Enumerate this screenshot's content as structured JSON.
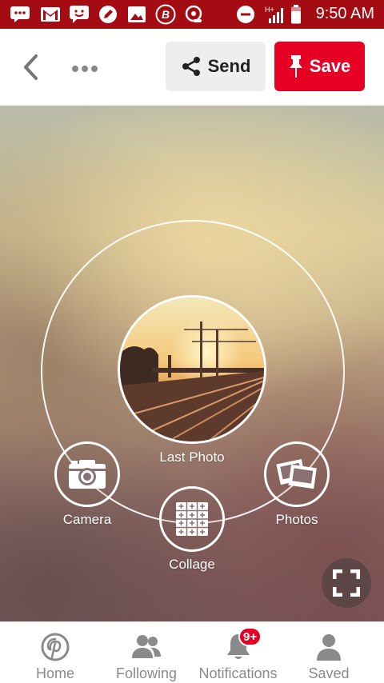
{
  "status_bar": {
    "time": "9:50 AM",
    "icons": [
      "chat-icon",
      "gmail-icon",
      "sms-icon",
      "edit-icon",
      "image-icon",
      "bolt-icon",
      "headset-icon",
      "dnd-icon",
      "signal-icon",
      "battery-icon"
    ],
    "network_label": "H+",
    "color": "#a50b12"
  },
  "toolbar": {
    "send_label": "Send",
    "save_label": "Save",
    "accent": "#e60023"
  },
  "camera": {
    "last_photo_label": "Last Photo",
    "camera_label": "Camera",
    "collage_label": "Collage",
    "photos_label": "Photos"
  },
  "nav": {
    "items": [
      {
        "label": "Home",
        "icon": "pinterest-icon"
      },
      {
        "label": "Following",
        "icon": "people-icon"
      },
      {
        "label": "Notifications",
        "icon": "bell-icon",
        "badge": "9+"
      },
      {
        "label": "Saved",
        "icon": "person-icon"
      }
    ]
  }
}
